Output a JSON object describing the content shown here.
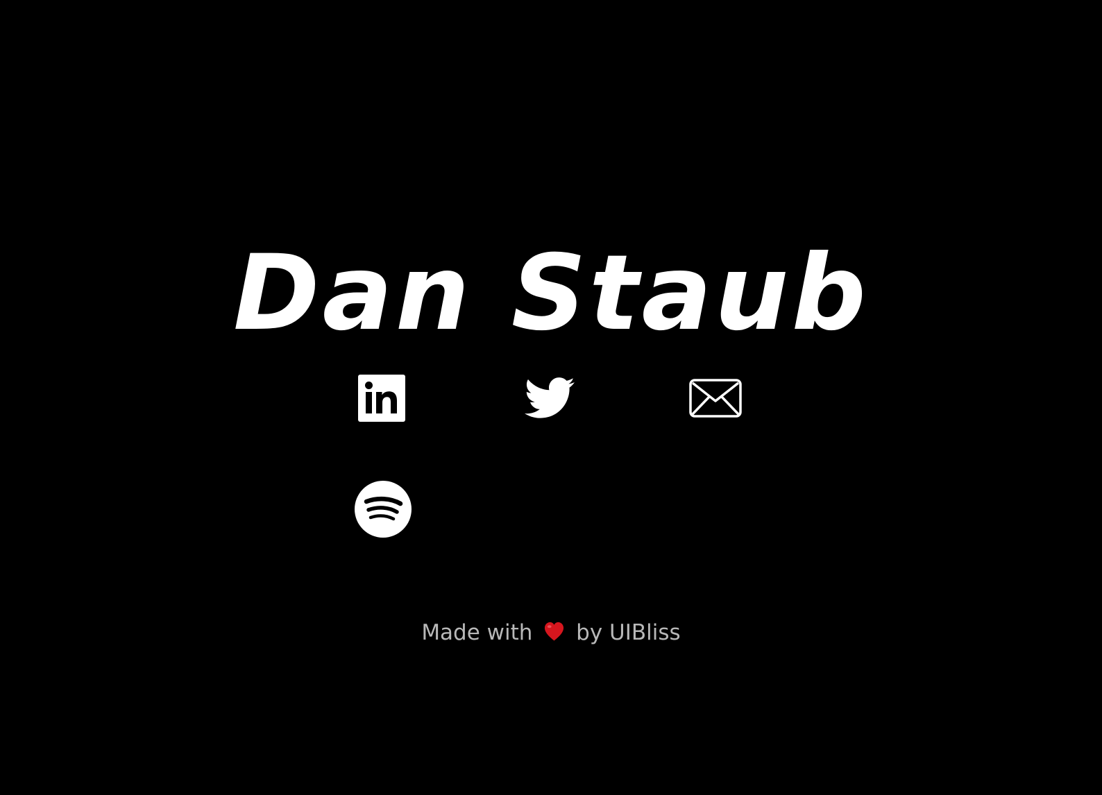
{
  "profile": {
    "name": "Dan Staub"
  },
  "social_links": [
    {
      "icon": "linkedin-icon",
      "label": "LinkedIn"
    },
    {
      "icon": "twitter-icon",
      "label": "Twitter"
    },
    {
      "icon": "envelope-icon",
      "label": "Email"
    },
    {
      "icon": "spotify-icon",
      "label": "Spotify"
    }
  ],
  "footer": {
    "prefix": "Made with",
    "heart_icon": "heart-icon",
    "by": "by",
    "credit": "UIBliss"
  },
  "colors": {
    "background": "#000000",
    "title": "#ffffff",
    "icons": "#ffffff",
    "footer_text": "#b8b8b8",
    "heart": "#d6161e"
  }
}
